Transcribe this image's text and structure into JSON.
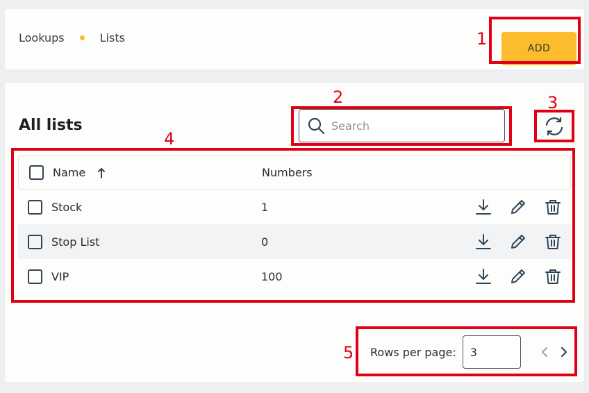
{
  "breadcrumb": {
    "items": [
      "Lookups",
      "Lists"
    ]
  },
  "header": {
    "add_label": "ADD"
  },
  "main": {
    "title": "All lists",
    "search": {
      "placeholder": "Search",
      "value": ""
    },
    "table": {
      "columns": {
        "name": "Name",
        "numbers": "Numbers"
      },
      "sort": {
        "column": "Name",
        "direction": "ascending"
      },
      "rows": [
        {
          "name": "Stock",
          "numbers": "1"
        },
        {
          "name": "Stop List",
          "numbers": "0"
        },
        {
          "name": "VIP",
          "numbers": "100"
        }
      ]
    },
    "pagination": {
      "rows_label": "Rows per page:",
      "rows_value": "3"
    }
  },
  "annotations": [
    "1",
    "2",
    "3",
    "4",
    "5"
  ],
  "colors": {
    "accent": "#fbbd2d",
    "annotation": "#e00016",
    "icon": "#2f4556"
  },
  "icons": [
    "search-icon",
    "refresh-icon",
    "sort-arrow-up-icon",
    "download-icon",
    "edit-pencil-icon",
    "trash-icon",
    "chevron-left-icon",
    "chevron-right-icon"
  ]
}
